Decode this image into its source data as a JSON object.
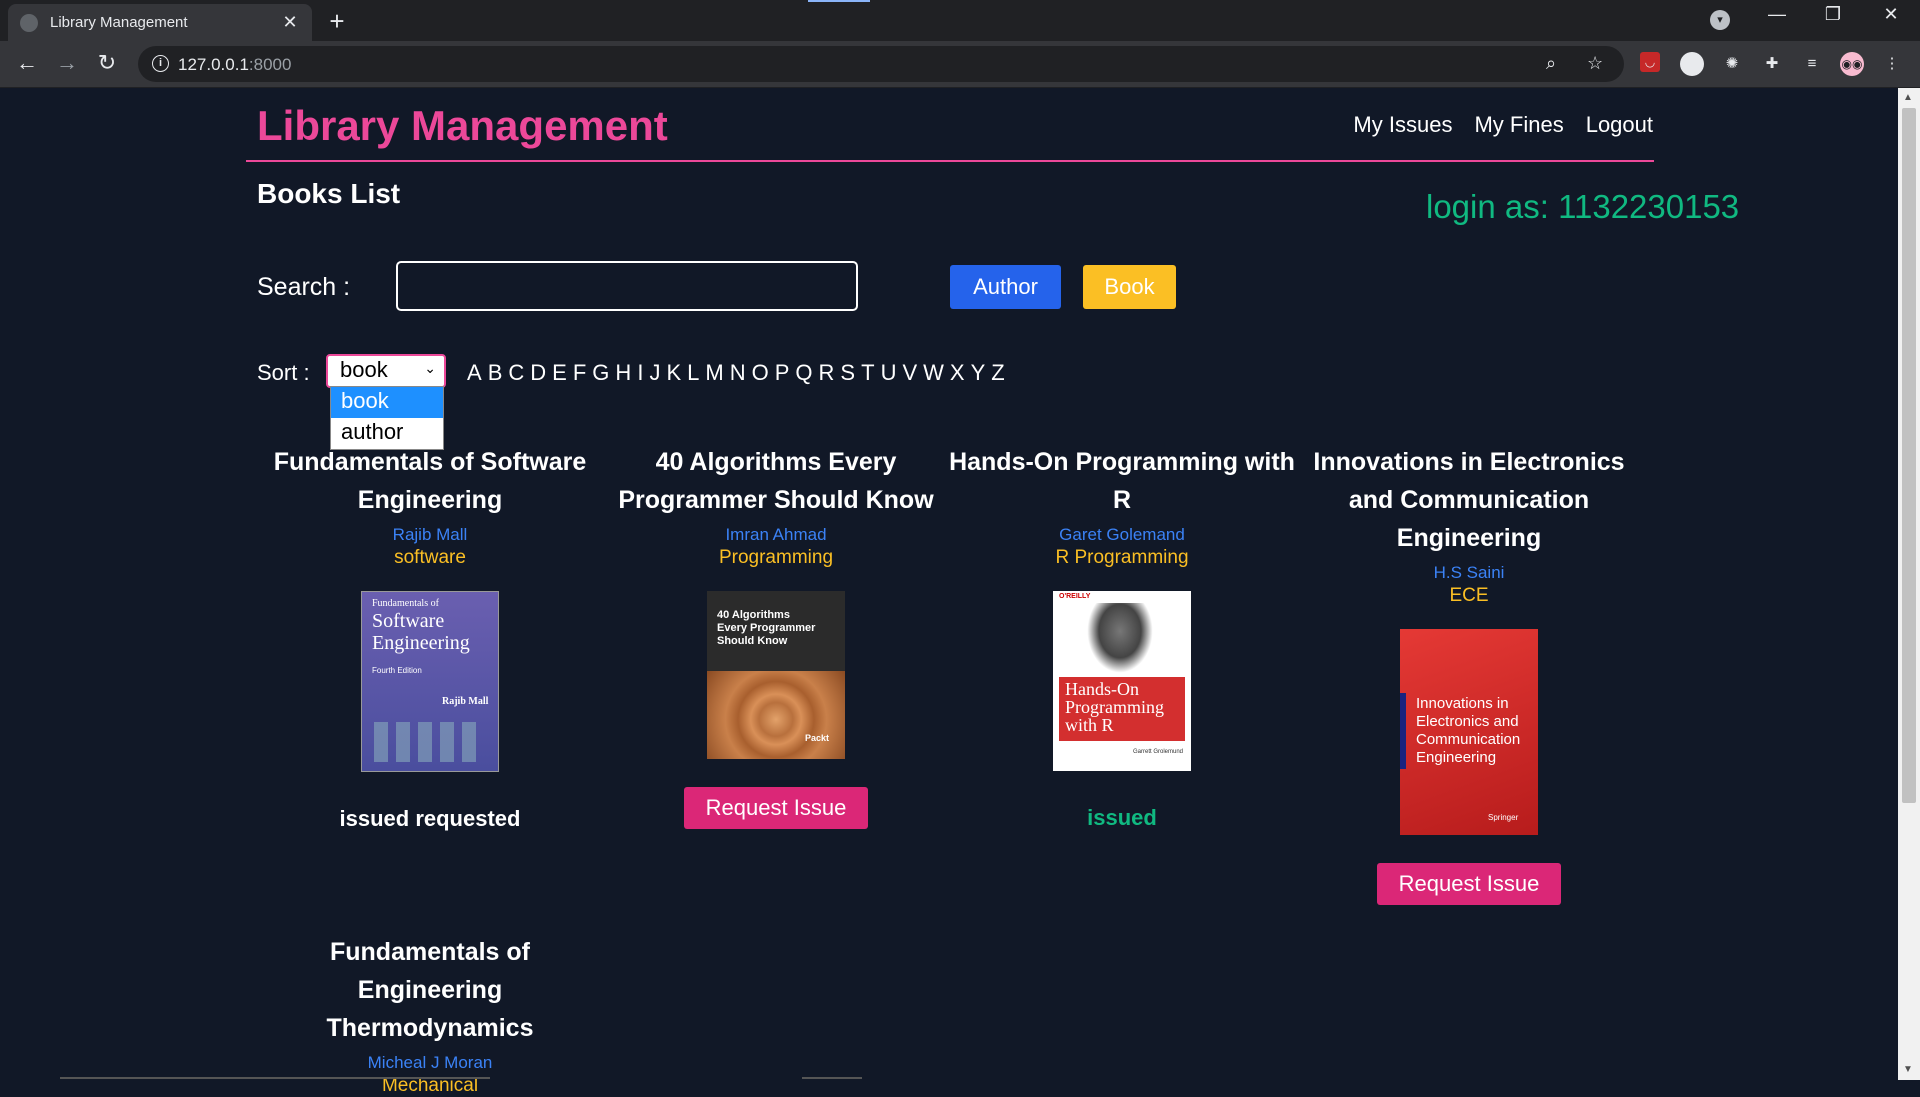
{
  "browser": {
    "tab_title": "Library Management",
    "url_host": "127.0.0.1",
    "url_port": ":8000"
  },
  "header": {
    "brand": "Library Management",
    "nav": [
      "My Issues",
      "My Fines",
      "Logout"
    ]
  },
  "page": {
    "title": "Books List",
    "login_as": "login as: 1132230153"
  },
  "search": {
    "label": "Search :",
    "value": "",
    "author_button": "Author",
    "book_button": "Book"
  },
  "sort": {
    "label": "Sort :",
    "selected": "book",
    "options": [
      "book",
      "author"
    ],
    "letters": [
      "A",
      "B",
      "C",
      "D",
      "E",
      "F",
      "G",
      "H",
      "I",
      "J",
      "K",
      "L",
      "M",
      "N",
      "O",
      "P",
      "Q",
      "R",
      "S",
      "T",
      "U",
      "V",
      "W",
      "X",
      "Y",
      "Z"
    ]
  },
  "books": [
    {
      "title": "Fundamentals of Software Engineering",
      "author": "Rajib Mall",
      "category": "software",
      "status": "issued requested",
      "cover_lines": [
        "Fundamentals of",
        "Software",
        "Engineering",
        "Fourth Edition",
        "Rajib Mall"
      ]
    },
    {
      "title": "40 Algorithms Every Programmer Should Know",
      "author": "Imran Ahmad",
      "category": "Programming",
      "action": "Request Issue",
      "cover_lines": [
        "40 Algorithms",
        "Every Programmer",
        "Should Know",
        "Packt"
      ]
    },
    {
      "title": "Hands-On Programming with R",
      "author": "Garet Golemand",
      "category": "R Programming",
      "status": "issued",
      "cover_lines": [
        "O'REILLY",
        "Hands-On",
        "Programming",
        "with R",
        "Garrett Grolemund"
      ]
    },
    {
      "title": "Innovations in Electronics and Communication Engineering",
      "author": "H.S Saini",
      "category": "ECE",
      "action": "Request Issue",
      "cover_lines": [
        "Innovations in",
        "Electronics and",
        "Communication",
        "Engineering",
        "Springer"
      ]
    },
    {
      "title": "Fundamentals of Engineering Thermodynamics",
      "author": "Micheal J Moran",
      "category": "Mechanical"
    }
  ],
  "colors": {
    "background": "#111827",
    "brand": "#ec4899",
    "login_as": "#10b981",
    "author_btn": "#2563eb",
    "book_btn": "#fbbf24",
    "request_btn": "#db2777",
    "issued": "#10b981"
  }
}
